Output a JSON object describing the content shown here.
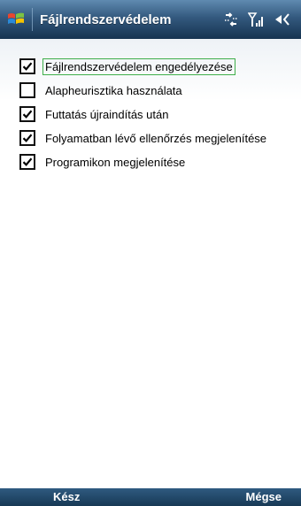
{
  "titlebar": {
    "title": "Fájlrendszervédelem",
    "icons": [
      "windows-flag-icon",
      "data-connection-icon",
      "signal-strength-icon",
      "speaker-icon"
    ]
  },
  "options": [
    {
      "label": "Fájlrendszervédelem engedélyezése",
      "checked": true,
      "focused": true
    },
    {
      "label": "Alapheurisztika használata",
      "checked": false,
      "focused": false
    },
    {
      "label": "Futtatás újraindítás után",
      "checked": true,
      "focused": false
    },
    {
      "label": "Folyamatban lévő ellenőrzés megjelenítése",
      "checked": true,
      "focused": false
    },
    {
      "label": "Programikon megjelenítése",
      "checked": true,
      "focused": false
    }
  ],
  "softkeys": {
    "left": "Kész",
    "right": "Mégse"
  },
  "colors": {
    "focus_outline": "#3fae4a",
    "titlebar": "#33597e",
    "softbar": "#1f4465"
  }
}
